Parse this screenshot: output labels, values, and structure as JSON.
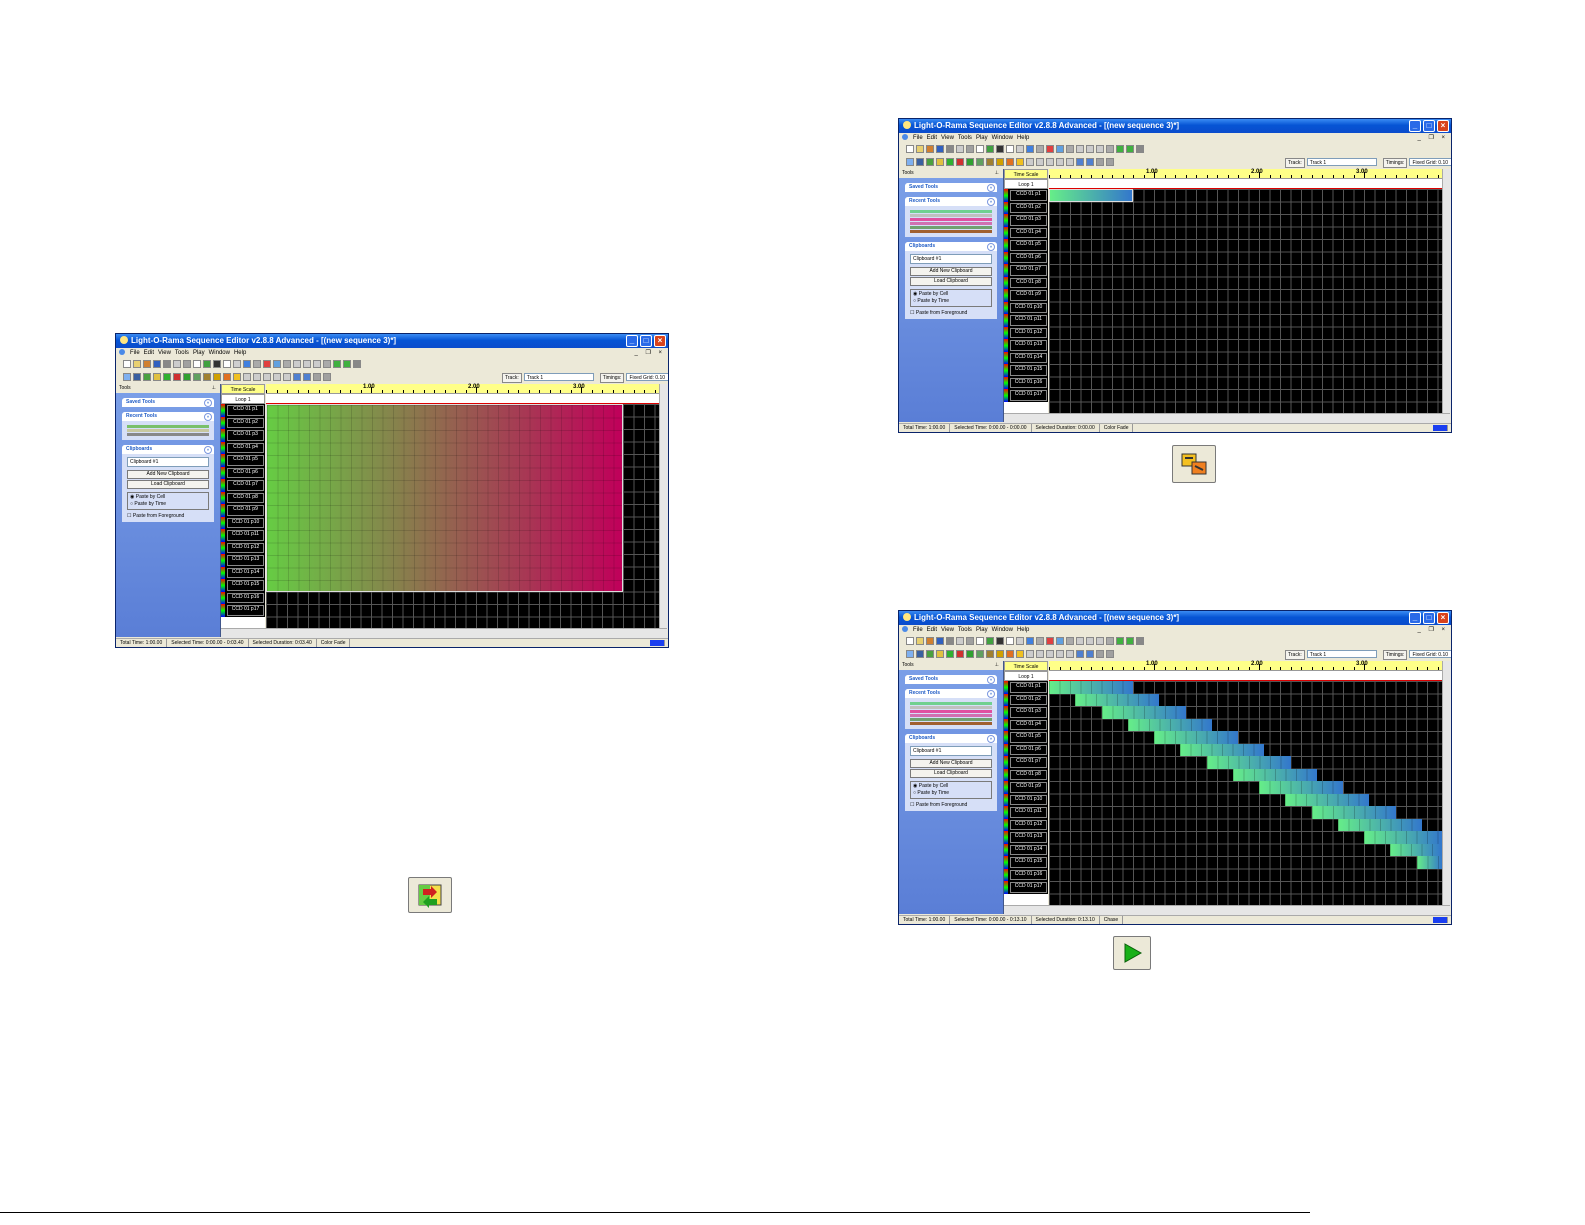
{
  "windows": [
    {
      "title": "Light-O-Rama Sequence Editor v2.8.8 Advanced - [(new sequence 3)*]",
      "menus": [
        "File",
        "Edit",
        "View",
        "Tools",
        "Play",
        "Window",
        "Help"
      ],
      "track_label": "Track:",
      "track_value": "Track 1",
      "timings_label": "Timings:",
      "timings_value": "Fixed Grid: 0.10",
      "tools_title": "Tools",
      "saved_tools": "Saved Tools",
      "recent_tools": "Recent Tools",
      "clipboards": "Clipboards",
      "clipboard_value": "Clipboard #1",
      "add_clipboard": "Add New Clipboard",
      "load_clipboard": "Load Clipboard",
      "paste_by_cell": "Paste by Cell",
      "paste_by_time": "Paste by Time",
      "paste_from_foreground": "Paste from Foreground",
      "time_scale": "Time Scale",
      "loop": "Loop 1",
      "ruler": [
        "1.00",
        "2.00",
        "3.00"
      ],
      "channels": [
        "CCD 01 p1",
        "CCD 01 p2",
        "CCD 01 p3",
        "CCD 01 p4",
        "CCD 01 p5",
        "CCD 01 p6",
        "CCD 01 p7",
        "CCD 01 p8",
        "CCD 01 p9",
        "CCD 01 p10",
        "CCD 01 p11",
        "CCD 01 p12",
        "CCD 01 p13",
        "CCD 01 p14",
        "CCD 01 p15",
        "CCD 01 p16",
        "CCD 01 p17"
      ],
      "status": [
        "Total Time: 1:00.00",
        "Selected Time: 0:00.00 - 0:03.40",
        "Selected Duration: 0:03.40",
        "Color Fade"
      ]
    },
    {
      "title": "Light-O-Rama Sequence Editor v2.8.8 Advanced - [(new sequence 3)*]",
      "menus": [
        "File",
        "Edit",
        "View",
        "Tools",
        "Play",
        "Window",
        "Help"
      ],
      "track_label": "Track:",
      "track_value": "Track 1",
      "timings_label": "Timings:",
      "timings_value": "Fixed Grid: 0.10",
      "tools_title": "Tools",
      "saved_tools": "Saved Tools",
      "recent_tools": "Recent Tools",
      "clipboards": "Clipboards",
      "clipboard_value": "Clipboard #1",
      "add_clipboard": "Add New Clipboard",
      "load_clipboard": "Load Clipboard",
      "paste_by_cell": "Paste by Cell",
      "paste_by_time": "Paste by Time",
      "paste_from_foreground": "Paste from Foreground",
      "time_scale": "Time Scale",
      "loop": "Loop 1",
      "ruler": [
        "1.00",
        "2.00",
        "3.00"
      ],
      "channels": [
        "CCD 01 p1",
        "CCD 01 p2",
        "CCD 01 p3",
        "CCD 01 p4",
        "CCD 01 p5",
        "CCD 01 p6",
        "CCD 01 p7",
        "CCD 01 p8",
        "CCD 01 p9",
        "CCD 01 p10",
        "CCD 01 p11",
        "CCD 01 p12",
        "CCD 01 p13",
        "CCD 01 p14",
        "CCD 01 p15",
        "CCD 01 p16",
        "CCD 01 p17"
      ],
      "status": [
        "Total Time: 1:00.00",
        "Selected Time: 0:00.00 - 0:00.00",
        "Selected Duration: 0:00.00",
        "Color Fade"
      ]
    },
    {
      "title": "Light-O-Rama Sequence Editor v2.8.8 Advanced - [(new sequence 3)*]",
      "menus": [
        "File",
        "Edit",
        "View",
        "Tools",
        "Play",
        "Window",
        "Help"
      ],
      "track_label": "Track:",
      "track_value": "Track 1",
      "timings_label": "Timings:",
      "timings_value": "Fixed Grid: 0.10",
      "tools_title": "Tools",
      "saved_tools": "Saved Tools",
      "recent_tools": "Recent Tools",
      "clipboards": "Clipboards",
      "clipboard_value": "Clipboard #1",
      "add_clipboard": "Add New Clipboard",
      "load_clipboard": "Load Clipboard",
      "paste_by_cell": "Paste by Cell",
      "paste_by_time": "Paste by Time",
      "paste_from_foreground": "Paste from Foreground",
      "time_scale": "Time Scale",
      "loop": "Loop 1",
      "ruler": [
        "1.00",
        "2.00",
        "3.00"
      ],
      "channels": [
        "CCD 01 p1",
        "CCD 01 p2",
        "CCD 01 p3",
        "CCD 01 p4",
        "CCD 01 p5",
        "CCD 01 p6",
        "CCD 01 p7",
        "CCD 01 p8",
        "CCD 01 p9",
        "CCD 01 p10",
        "CCD 01 p11",
        "CCD 01 p12",
        "CCD 01 p13",
        "CCD 01 p14",
        "CCD 01 p15",
        "CCD 01 p16",
        "CCD 01 p17"
      ],
      "status": [
        "Total Time: 1:00.00",
        "Selected Time: 0:00.00 - 0:13.10",
        "Selected Duration: 0:13.10",
        "Chase"
      ]
    }
  ],
  "icons": [
    "color-fade-paste-icon",
    "clipboard-paste-icon",
    "play-icon"
  ],
  "colors": {
    "fade_start": "#66cc44",
    "fade_end": "#c0005a",
    "chase_start": "#66ee88",
    "chase_end": "#3377cc",
    "grid_bg": "#000000",
    "ruler_bg": "#ffff88"
  }
}
